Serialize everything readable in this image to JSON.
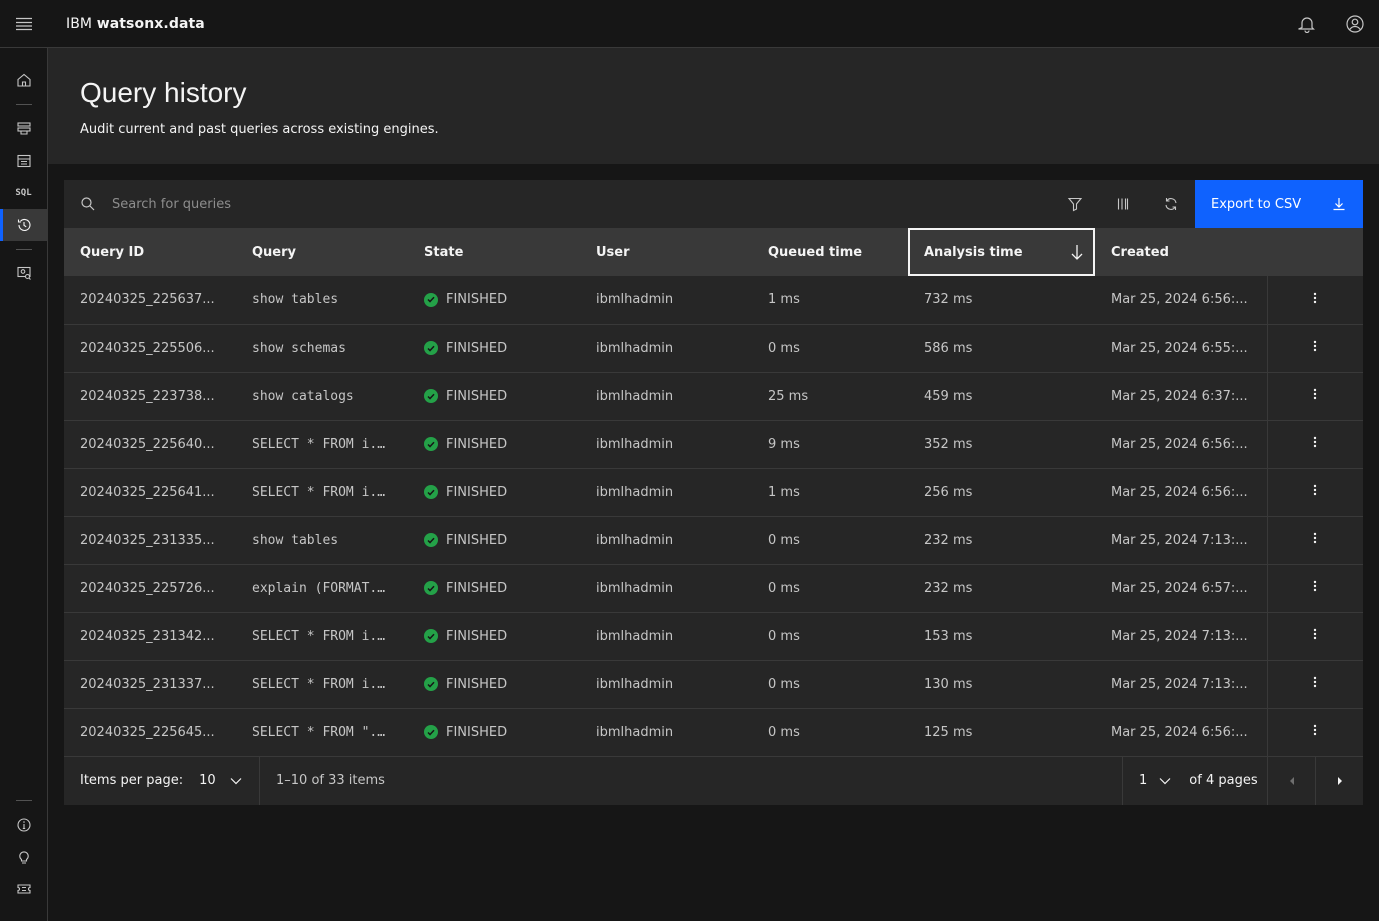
{
  "header": {
    "brand_prefix": "IBM",
    "brand_product": "watsonx.data"
  },
  "page": {
    "title": "Query history",
    "subtitle": "Audit current and past queries across existing engines."
  },
  "rail": {
    "sql_label": "SQL"
  },
  "toolbar": {
    "search_placeholder": "Search for queries",
    "export_label": "Export to CSV"
  },
  "table": {
    "columns": [
      "Query ID",
      "Query",
      "State",
      "User",
      "Queued time",
      "Analysis time",
      "Created"
    ],
    "rows": [
      {
        "id": "20240325_225637...",
        "query": "show tables",
        "state": "FINISHED",
        "user": "ibmlhadmin",
        "queued": "1 ms",
        "analysis": "732 ms",
        "created": "Mar 25, 2024 6:56:..."
      },
      {
        "id": "20240325_225506...",
        "query": "show schemas",
        "state": "FINISHED",
        "user": "ibmlhadmin",
        "queued": "0 ms",
        "analysis": "586 ms",
        "created": "Mar 25, 2024 6:55:..."
      },
      {
        "id": "20240325_223738...",
        "query": "show catalogs",
        "state": "FINISHED",
        "user": "ibmlhadmin",
        "queued": "25 ms",
        "analysis": "459 ms",
        "created": "Mar 25, 2024 6:37:..."
      },
      {
        "id": "20240325_225640...",
        "query": "SELECT * FROM i...",
        "state": "FINISHED",
        "user": "ibmlhadmin",
        "queued": "9 ms",
        "analysis": "352 ms",
        "created": "Mar 25, 2024 6:56:..."
      },
      {
        "id": "20240325_225641...",
        "query": "SELECT * FROM i...",
        "state": "FINISHED",
        "user": "ibmlhadmin",
        "queued": "1 ms",
        "analysis": "256 ms",
        "created": "Mar 25, 2024 6:56:..."
      },
      {
        "id": "20240325_231335...",
        "query": "show tables",
        "state": "FINISHED",
        "user": "ibmlhadmin",
        "queued": "0 ms",
        "analysis": "232 ms",
        "created": "Mar 25, 2024 7:13:..."
      },
      {
        "id": "20240325_225726...",
        "query": "explain (FORMAT...",
        "state": "FINISHED",
        "user": "ibmlhadmin",
        "queued": "0 ms",
        "analysis": "232 ms",
        "created": "Mar 25, 2024 6:57:..."
      },
      {
        "id": "20240325_231342...",
        "query": "SELECT * FROM i...",
        "state": "FINISHED",
        "user": "ibmlhadmin",
        "queued": "0 ms",
        "analysis": "153 ms",
        "created": "Mar 25, 2024 7:13:..."
      },
      {
        "id": "20240325_231337...",
        "query": "SELECT * FROM i...",
        "state": "FINISHED",
        "user": "ibmlhadmin",
        "queued": "0 ms",
        "analysis": "130 ms",
        "created": "Mar 25, 2024 7:13:..."
      },
      {
        "id": "20240325_225645...",
        "query": "SELECT * FROM \"...",
        "state": "FINISHED",
        "user": "ibmlhadmin",
        "queued": "0 ms",
        "analysis": "125 ms",
        "created": "Mar 25, 2024 6:56:..."
      }
    ]
  },
  "pagination": {
    "items_per_page_label": "Items per page:",
    "items_per_page": "10",
    "range_text": "1–10 of 33 items",
    "current_page": "1",
    "pages_text": "of 4 pages"
  },
  "colors": {
    "accent": "#0f62fe",
    "success": "#24a148",
    "background": "#161616",
    "layer": "#262626"
  }
}
